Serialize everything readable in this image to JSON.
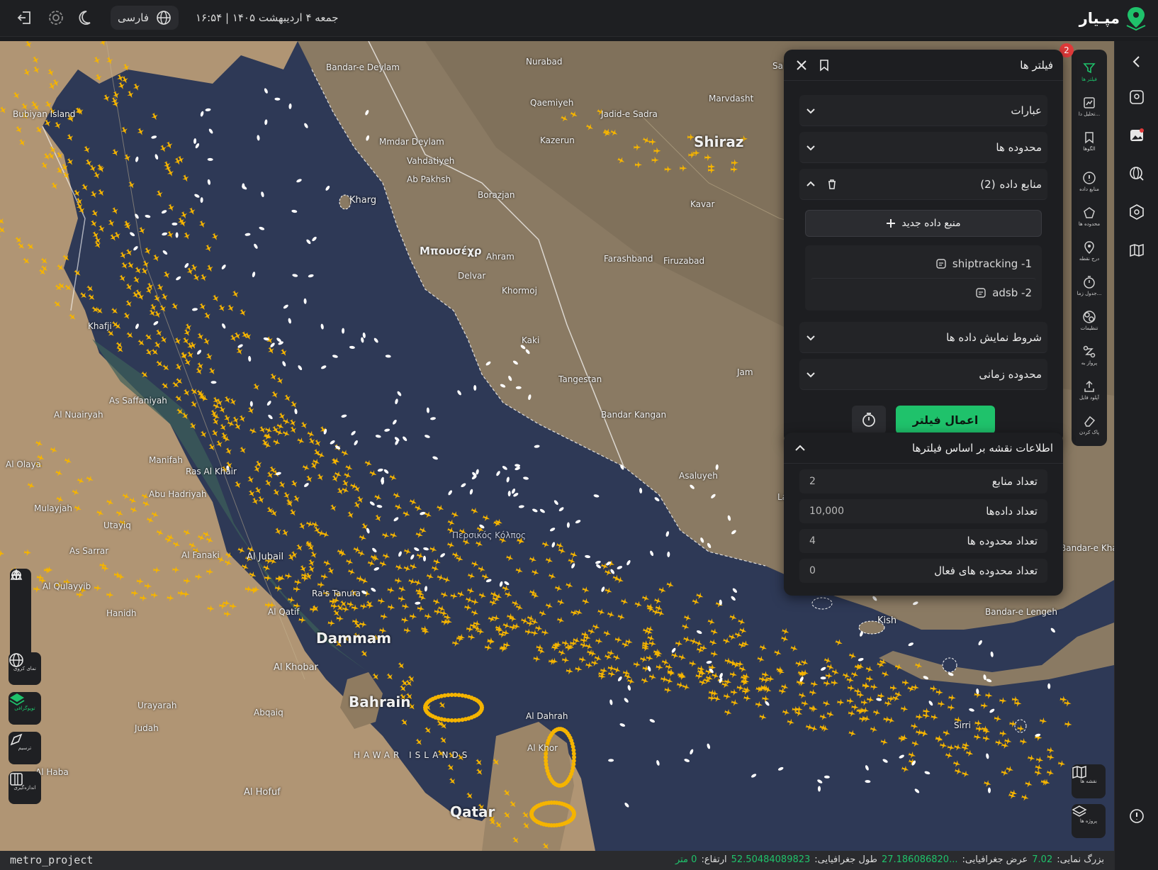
{
  "topbar": {
    "app_name": "مپـیار",
    "date_text": "جمعه ۴ اردیبهشت ۱۴۰۵  |  ۱۶:۵۴",
    "language_label": "فارسی"
  },
  "colors": {
    "accent": "#1fc26b",
    "badge": "#e03a3a",
    "aircraft": "#f5b400",
    "ship": "#ffffff",
    "sea": "#2e3956"
  },
  "filters_panel": {
    "title": "فیلتر ها",
    "badge_count": "2",
    "sections": {
      "phrases": "عبارات",
      "areas": "محدوده ها",
      "data_sources": "منابع داده",
      "data_sources_count": "(2)",
      "display_conditions": "شروط نمایش داده ها",
      "time_range": "محدوده زمانی"
    },
    "new_source_label": "منبع داده جدید",
    "sources": [
      {
        "label": "shiptracking -1"
      },
      {
        "label": "adsb -2"
      }
    ],
    "apply_label": "اعمال فیلتر"
  },
  "info_panel": {
    "title": "اطلاعات نقشه بر اساس فیلترها",
    "rows": [
      {
        "label": "تعداد منابع",
        "value": "2"
      },
      {
        "label": "تعداد داده‌ها",
        "value": "10,000"
      },
      {
        "label": "تعداد محدوده ها",
        "value": "4"
      },
      {
        "label": "تعداد محدوده های فعال",
        "value": "0"
      }
    ]
  },
  "tool_tray": [
    {
      "label": "فیلتر ها",
      "icon": "filter-icon"
    },
    {
      "label": "تحلیل دا...",
      "icon": "analysis-icon"
    },
    {
      "label": "الگوها",
      "icon": "bookmark-icon"
    },
    {
      "label": "منابع داده",
      "icon": "info-icon"
    },
    {
      "label": "محدوده ها",
      "icon": "polygon-icon"
    },
    {
      "label": "درج نقطه",
      "icon": "pin-icon"
    },
    {
      "label": "جدول زما...",
      "icon": "stopwatch-icon"
    },
    {
      "label": "تنظیمات",
      "icon": "settings-icon"
    },
    {
      "label": "پرواز به",
      "icon": "route-icon"
    },
    {
      "label": "آپلود فایل",
      "icon": "upload-icon"
    },
    {
      "label": "پاک کردن",
      "icon": "eraser-icon"
    }
  ],
  "bottom_right_tools": [
    {
      "label": "نقشه ها",
      "icon": "map-icon"
    },
    {
      "label": "پروژه ها",
      "icon": "layers-icon"
    }
  ],
  "left_tools": [
    {
      "label": "نمای کروی",
      "icon": "globe-icon"
    },
    {
      "label": "توپوگرافی",
      "icon": "topography-icon"
    },
    {
      "label": "ترسیم",
      "icon": "draw-icon"
    },
    {
      "label": "اندازه‌گیری",
      "icon": "ruler-icon"
    }
  ],
  "map_labels": [
    "Shiraz",
    "Kharg",
    "Μπουσέχρ",
    "Dammam",
    "Bahrain",
    "Qatar",
    "Al Khobar",
    "Kish",
    "Bandar-e Lengeh",
    "Mmdar Deylam",
    "Vahdatiyeh",
    "Borazjan",
    "Kazerun",
    "Firuzabad",
    "Kavar",
    "Kaki",
    "Delvar",
    "Ahram",
    "Khormoj",
    "Bandar Kangan",
    "Asaluyeh",
    "Jam",
    "Farashband",
    "Lamerd",
    "Bubiyan Island",
    "Al Nuairyah",
    "Al Qatif",
    "Abqaiq",
    "Urayarah",
    "Al Hofuf",
    "Hanidh",
    "Manifah",
    "Ras Al Khair",
    "Al Jubail",
    "As Saffaniyah",
    "Khafji",
    "HAWAR ISLANDS",
    "Περσικός Κόλπος",
    "Bandar-e Deylam",
    "Qaemiyeh",
    "Nurabad",
    "Marvdasht",
    "Sa'adat Shahr",
    "Jadid-e Sadra",
    "Ab Pakhsh",
    "Tangestan",
    "Bandar-e Khamir",
    "Al Olaya",
    "Mulayjah",
    "Utayiq",
    "Al Qulayyib",
    "As Sarrar",
    "Al Haba",
    "Ra's Tanura",
    "Al Fanaki",
    "Judah",
    "Abu Hadriyah",
    "Al Dahrah",
    "Al Khor",
    "Sirri"
  ],
  "statusbar": {
    "project": "metro_project",
    "zoom_label": "بزرگ نمایی:",
    "zoom_value": "7.02",
    "lat_label": "عرض جغرافیایی:",
    "lat_value": "27.186086820...",
    "lon_label": "طول جغرافیایی:",
    "lon_value": "52.50484089823",
    "alt_label": "ارتفاع:",
    "alt_value": "0 متر"
  }
}
